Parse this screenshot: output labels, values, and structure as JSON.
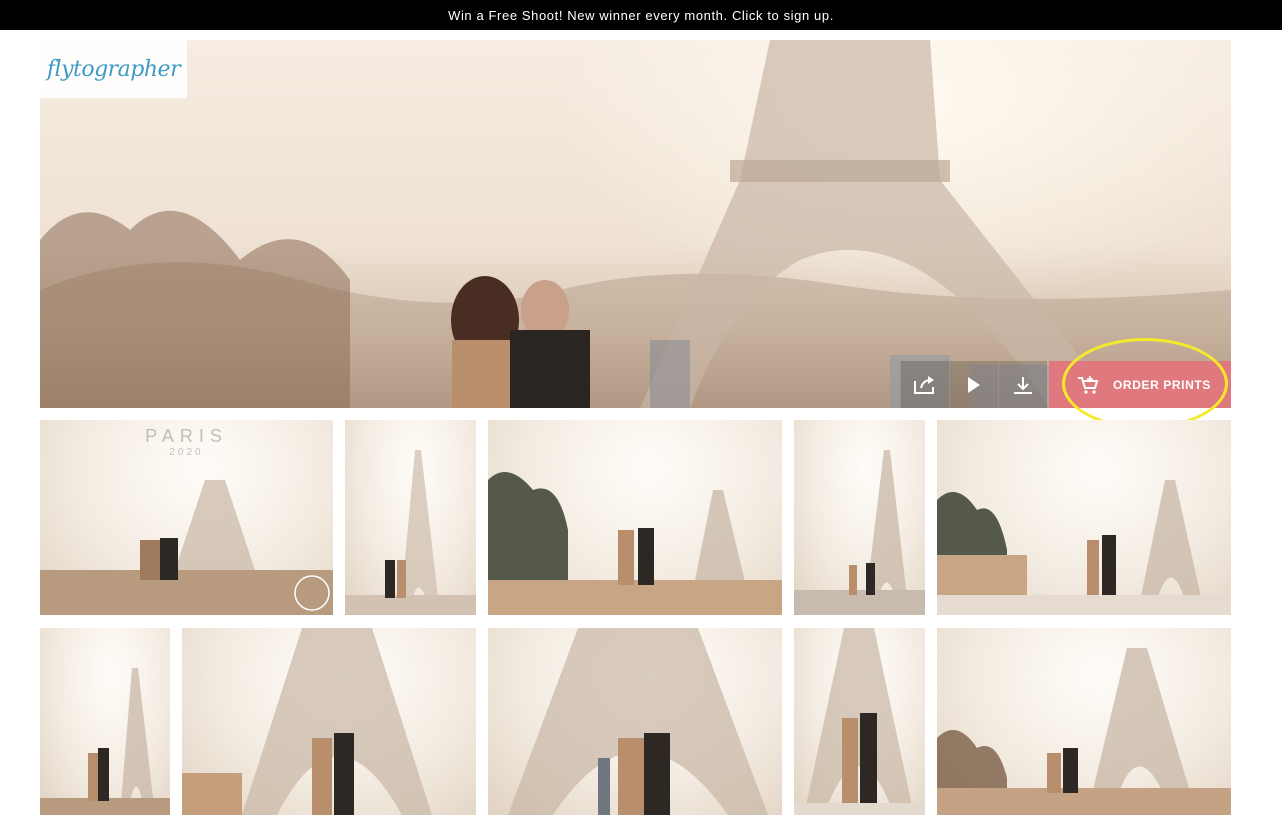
{
  "promo": {
    "text": "Win a Free Shoot! New winner every month. Click to sign up."
  },
  "brand": {
    "logo_text": "flytographer"
  },
  "toolbar": {
    "share_icon": "share-icon",
    "play_icon": "play-icon",
    "download_icon": "download-icon",
    "cart_icon": "cart-icon",
    "order_label": "ORDER PRINTS"
  },
  "gallery": {
    "watermark_title": "PARIS",
    "watermark_year": "2020"
  },
  "colors": {
    "order_button": "#e0797d",
    "highlight": "#f4ea2a",
    "logo": "#3e9bc6",
    "promo_bg": "#000000"
  }
}
